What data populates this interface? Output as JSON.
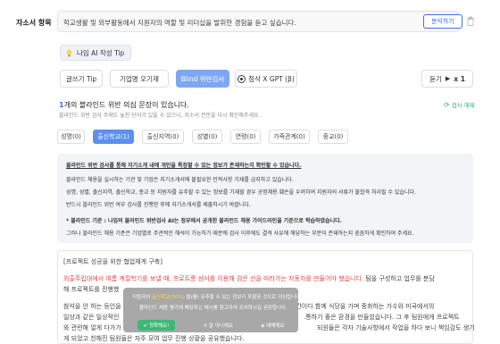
{
  "question": {
    "label": "자소서 항목",
    "text": "학교생활 및 외부활동에서 지원자의 역할 및 리더십을 발휘한 경험을 듣고 싶습니다.",
    "analyze_label": "분석하기"
  },
  "tip_label": "나임 AI 작성 Tip",
  "tools": {
    "items": [
      "글쓰기 Tip",
      "기업명 오기재",
      "Blind 위반검사",
      "첨삭 X GPT (β)"
    ],
    "listen_label": "듣기",
    "speed": "x 1"
  },
  "blind": {
    "count": "1",
    "title_suffix": "개의 블라인드 위반 의심 문장이 있습니다.",
    "subtitle": "블라인드 위반 검사 주에도 놓친 단어가 있을 수 있으니, 자소서 전문을 다시 확인해주세요.",
    "inspect_label": "검사 해제",
    "tabs": [
      "성명(0)",
      "출신학교(1)",
      "출신지역(0)",
      "성별(0)",
      "연령(0)",
      "가족관계(0)",
      "종교(0)"
    ],
    "active_tab": 1
  },
  "info": {
    "line1": "블라인드 위반 검사를 통해 자기소개 내에 개인을 특정할 수 있는 정보가 존재하는지 확인할 수 있습니다.",
    "line2": "블라인드 채용을 실시하는 기관 및 기업은 지기소개서에 불필요한 인적사항 기재를 금지하고 있습니다.",
    "line3": "성명, 성별, 출신지역, 출신학교, 종교 등 지원자를 유추할 수 있는 정보를 기재할 경우 공정채용 훼손을 우려하여 지원자의 서류가 불합격 처리될 수 있습니다.",
    "line4": "반드시 블라인드 위반 여부 검사를 진행한 후에 자기소개서를 제출하시기 바랍니다.",
    "line5": "* 블라인드 기준 : 나임의 블라인드 위반검사 AI는 정부에서 공개한 블라인드 채용 가이드라인을 기준으로 학습하였습니다.",
    "line6": "그러나 블라인드 채용 기준은 기업별로 주관적인 해석이 가능하기 때문에 검사 이후에도 결격 사유에 해당하는 부분이 존재하는지 꼼꼼하게 확인하여 주세요."
  },
  "essay": {
    "header": "[프로젝트 성공을 위한 협업체계 구축]",
    "highlight": "외출주립대에서 여름 계절학기를 보낼 때, 프로트롱 센서를 이용해 검은 선을 따라가는 자동차를 만들어야 했습니다.",
    "line1_tail": " 팀을 구성하고 업무를 분담",
    "line2": "해 프로젝트를 진행했",
    "line3_left": "참석을 안 하는 등인을",
    "line3_right": "[시사]간이다 함께 식당을 가며 중화하는 가수와 미국에서의",
    "line4_left": "일상과 같은 일상적인",
    "line4_right": ".통하기 좋은 환경을 만들었습니다. 그 후 팀원에게 프로젝트",
    "line5_left": "와 관련해 얼게 다가가",
    "line5_right": "되원들은 각자 기술사항에서 작업을 하다 보니 책임감도 생기",
    "line6": "게 되었고 친해진 팀원들은 자주 모여 업무 진행 상황을 공유했습니다."
  },
  "popup": {
    "line1": "지원자의 출신학교(50%) 을(를) 유추할 수 있는 정보가 포함된 것으로 의심됩니다.",
    "line1_highlight": "출신학교(50%)",
    "line2": "블라인드 채용 평가에 해당하는 예시를 참고하여 조치하시길 권장합니다.",
    "ok_label": "정확해요!",
    "wrong_label": "잘 아니에요",
    "unclear_label": "애매해요"
  }
}
